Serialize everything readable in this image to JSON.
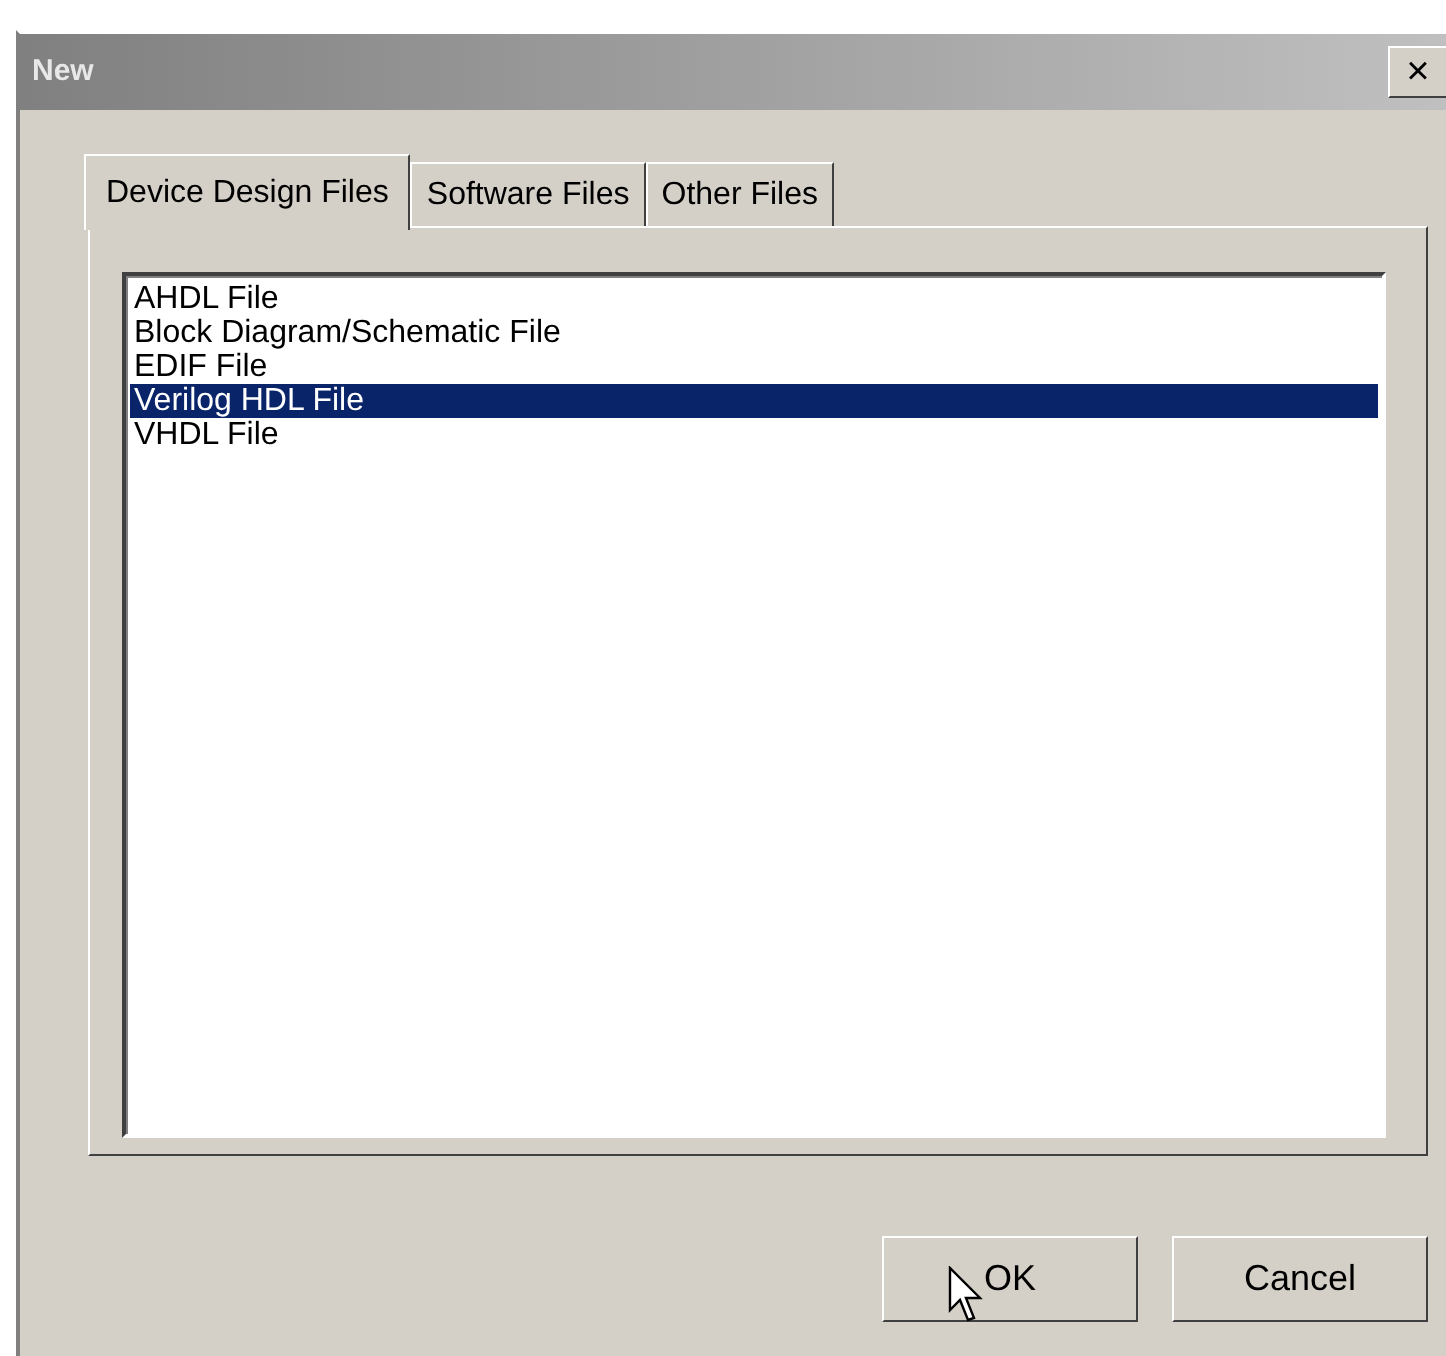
{
  "window": {
    "title": "New",
    "close": "×"
  },
  "tabs": [
    {
      "label": "Device Design Files",
      "selected": true
    },
    {
      "label": "Software Files",
      "selected": false
    },
    {
      "label": "Other Files",
      "selected": false
    }
  ],
  "list": [
    {
      "label": "AHDL File",
      "selected": false
    },
    {
      "label": "Block Diagram/Schematic File",
      "selected": false
    },
    {
      "label": "EDIF File",
      "selected": false
    },
    {
      "label": "Verilog HDL File",
      "selected": true
    },
    {
      "label": "VHDL File",
      "selected": false
    }
  ],
  "buttons": [
    "OK",
    "Cancel"
  ]
}
